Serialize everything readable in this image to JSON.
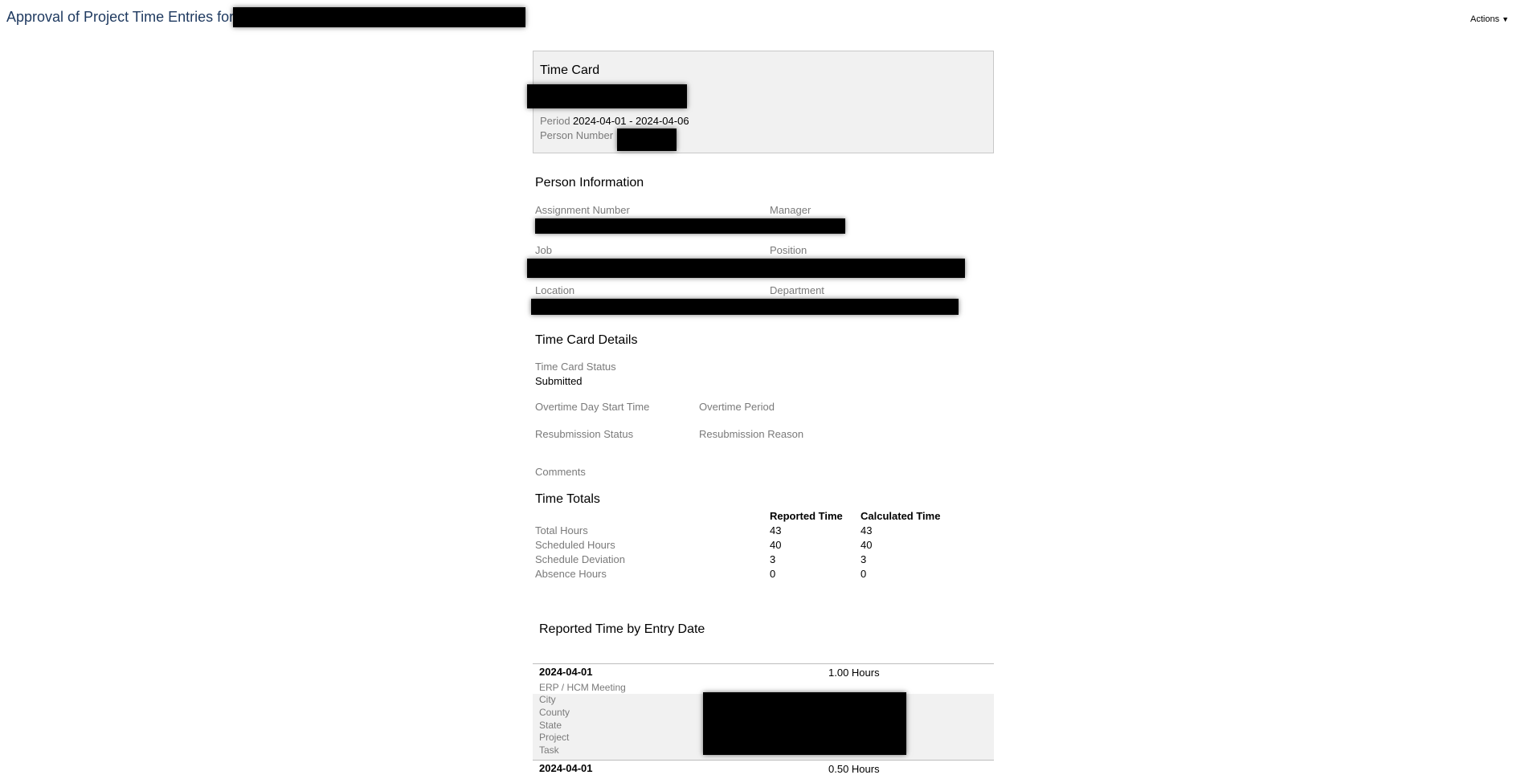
{
  "page_title": "Approval of Project Time Entries for",
  "actions_label": "Actions",
  "time_card": {
    "heading": "Time Card",
    "period_label": "Period",
    "period_value": "2024-04-01 - 2024-04-06",
    "person_number_label": "Person Number"
  },
  "person_info": {
    "heading": "Person Information",
    "assignment_number_label": "Assignment Number",
    "manager_label": "Manager",
    "job_label": "Job",
    "position_label": "Position",
    "location_label": "Location",
    "department_label": "Department"
  },
  "details": {
    "heading": "Time Card Details",
    "status_label": "Time Card Status",
    "status_value": "Submitted",
    "overtime_day_start_label": "Overtime Day Start Time",
    "overtime_period_label": "Overtime Period",
    "resubmission_status_label": "Resubmission Status",
    "resubmission_reason_label": "Resubmission Reason",
    "comments_label": "Comments"
  },
  "totals": {
    "heading": "Time Totals",
    "col_reported": "Reported Time",
    "col_calculated": "Calculated Time",
    "rows": [
      {
        "label": "Total Hours",
        "reported": "43",
        "calculated": "43"
      },
      {
        "label": "Scheduled Hours",
        "reported": "40",
        "calculated": "40"
      },
      {
        "label": "Schedule Deviation",
        "reported": "3",
        "calculated": "3"
      },
      {
        "label": "Absence Hours",
        "reported": "0",
        "calculated": "0"
      }
    ]
  },
  "entries": {
    "heading": "Reported Time by Entry Date",
    "items": [
      {
        "date": "2024-04-01",
        "hours": "1.00 Hours",
        "type": "ERP / HCM Meeting",
        "attributes": [
          "City",
          "County",
          "State",
          "Project",
          "Task"
        ]
      },
      {
        "date": "2024-04-01",
        "hours": "0.50 Hours"
      }
    ]
  }
}
